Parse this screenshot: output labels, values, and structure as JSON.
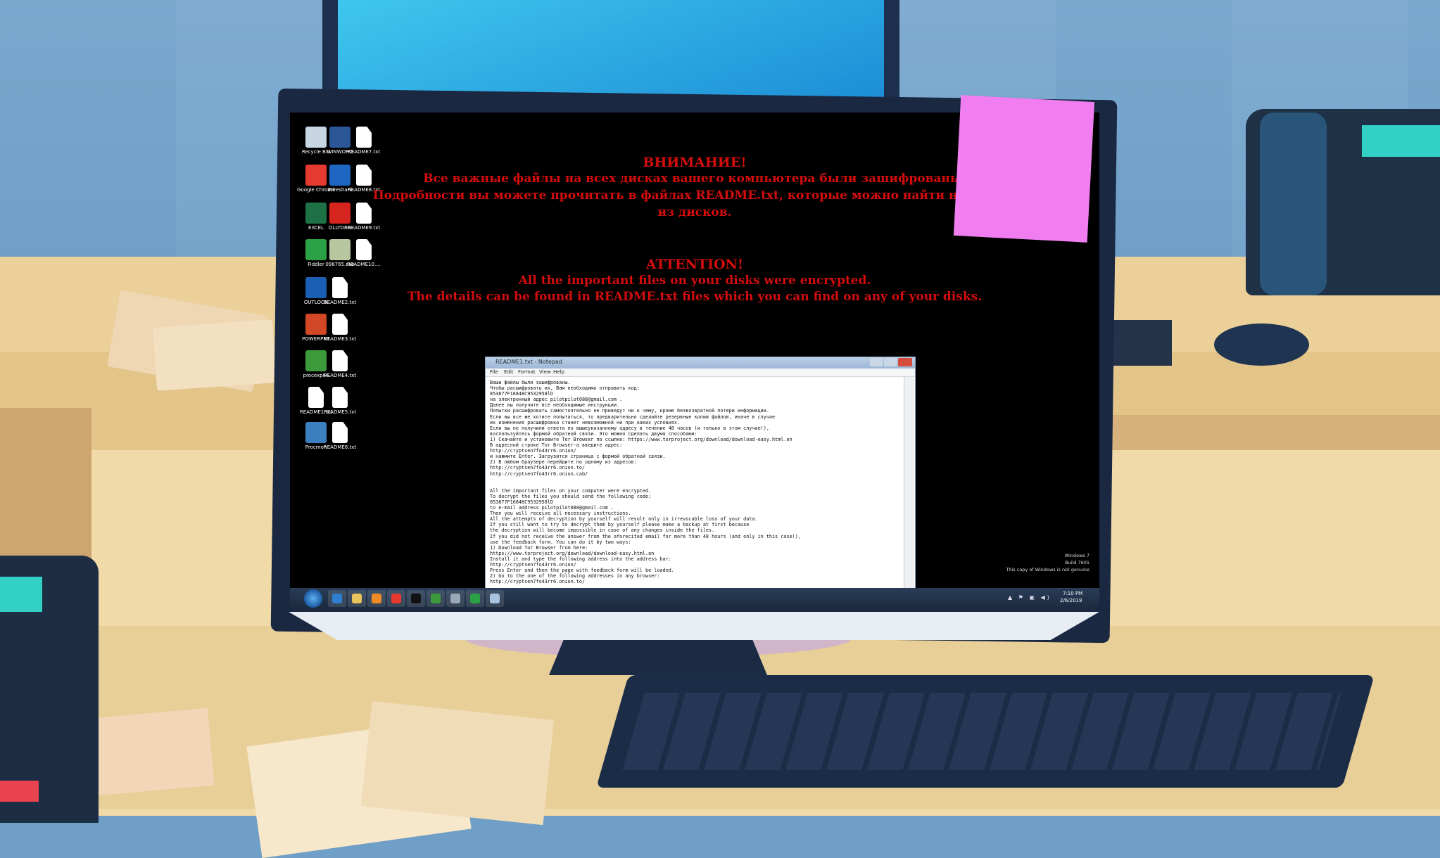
{
  "desktop": {
    "icons": [
      {
        "label": "Recycle Bin",
        "icon": "recycle-bin-icon",
        "color": "#c8d6e4"
      },
      {
        "label": "WINWORD",
        "icon": "word-icon",
        "color": "#2b5797"
      },
      {
        "label": "README7.txt",
        "icon": "text-file-icon",
        "color": "#ffffff"
      },
      {
        "label": "Google Chrome",
        "icon": "chrome-icon",
        "color": "#e6392f"
      },
      {
        "label": "Wireshark",
        "icon": "wireshark-icon",
        "color": "#1f66c2"
      },
      {
        "label": "README8.txt",
        "icon": "text-file-icon",
        "color": "#ffffff"
      },
      {
        "label": "EXCEL",
        "icon": "excel-icon",
        "color": "#1e7145"
      },
      {
        "label": "OLLYDBG",
        "icon": "ollydbg-icon",
        "color": "#d6241f"
      },
      {
        "label": "README9.txt",
        "icon": "text-file-icon",
        "color": "#ffffff"
      },
      {
        "label": "Fiddler",
        "icon": "fiddler-icon",
        "color": "#2aa144"
      },
      {
        "label": "098765.exe",
        "icon": "exe-icon",
        "color": "#b8c7a0"
      },
      {
        "label": "README10....",
        "icon": "text-file-icon",
        "color": "#ffffff"
      },
      {
        "label": "OUTLOOK",
        "icon": "outlook-icon",
        "color": "#1a5fb4"
      },
      {
        "label": "README2.txt",
        "icon": "text-file-icon",
        "color": "#ffffff"
      },
      {
        "label": "POWERPNT",
        "icon": "powerpoint-icon",
        "color": "#d24726"
      },
      {
        "label": "README3.txt",
        "icon": "text-file-icon",
        "color": "#ffffff"
      },
      {
        "label": "procexp64",
        "icon": "procexp-icon",
        "color": "#3c9a3c"
      },
      {
        "label": "README4.txt",
        "icon": "text-file-icon",
        "color": "#ffffff"
      },
      {
        "label": "README1.txt",
        "icon": "text-file-icon",
        "color": "#ffffff"
      },
      {
        "label": "README5.txt",
        "icon": "text-file-icon",
        "color": "#ffffff"
      },
      {
        "label": "Procmon",
        "icon": "procmon-icon",
        "color": "#3c7fc0"
      },
      {
        "label": "README6.txt",
        "icon": "text-file-icon",
        "color": "#ffffff"
      }
    ]
  },
  "ransom_note": {
    "ru_heading": "ВНИМАНИЕ!",
    "ru_line1": "Все важные файлы на всех дисках вашего компьютера были зашифрованы.",
    "ru_line2": "Подробности вы можете прочитать в файлах README.txt, которые можно найти на любом",
    "ru_line3": "из дисков.",
    "en_heading": "ATTENTION!",
    "en_line1": "All the important files on your disks were encrypted.",
    "en_line2": "The details can be found in README.txt files which you can find on any of your disks.",
    "color": "#d40d0d"
  },
  "notepad": {
    "title": "README1.txt - Notepad",
    "menu": [
      "File",
      "Edit",
      "Format",
      "View",
      "Help"
    ],
    "lines": [
      "Ваши файлы были зашифрованы.",
      "Чтобы расшифровать их, Вам необходимо отправить код:",
      "853877F16848C9532958lD",
      "на электронный адрес pilotpilot088@gmail.com .",
      "Далее вы получите все необходимые инструкции.",
      "Попытки расшифровать самостоятельно не приведут ни к чему, кроме безвозвратной потери информации.",
      "Если вы все же хотите попытаться, то предварительно сделайте резервные копии файлов, иначе в случае",
      "их изменения расшифровка станет невозможной ни при каких условиях.",
      "Если вы не получили ответа по вышеуказанному адресу в течение 48 часов (и только в этом случае!),",
      "воспользуйтесь формой обратной связи. Это можно сделать двумя способами:",
      "1) Скачайте и установите Tor Browser по ссылке: https://www.torproject.org/download/download-easy.html.en",
      "В адресной строке Tor Browser-а введите адрес:",
      "http://cryptsen7fo43rr6.onion/",
      "и нажмите Enter. Загрузится страница с формой обратной связи.",
      "2) В любом браузере перейдите по одному из адресов:",
      "http://cryptsen7fo43rr6.onion.to/",
      "http://cryptsen7fo43rr6.onion.cab/",
      "",
      "",
      "All the important files on your computer were encrypted.",
      "To decrypt the files you should send the following code:",
      "853877F16848C9532958lD",
      "to e-mail address pilotpilot088@gmail.com .",
      "Then you will receive all necessary instructions.",
      "All the attempts of decryption by yourself will result only in irrevocable loss of your data.",
      "If you still want to try to decrypt them by yourself please make a backup at first because",
      "the decryption will become impossible in case of any changes inside the files.",
      "If you did not receive the answer from the aforecited email for more than 48 hours (and only in this case!),",
      "use the feedback form. You can do it by two ways:",
      "1) Download Tor Browser from here:",
      "https://www.torproject.org/download/download-easy.html.en",
      "Install it and type the following address into the address bar:",
      "http://cryptsen7fo43rr6.onion/",
      "Press Enter and then the page with feedback form will be loaded.",
      "2) Go to the one of the following addresses in any browser:",
      "http://cryptsen7fo43rr6.onion.to/"
    ]
  },
  "taskbar": {
    "items": [
      {
        "icon": "ie-icon",
        "color": "#2f7fd1"
      },
      {
        "icon": "explorer-icon",
        "color": "#e8c25a"
      },
      {
        "icon": "media-player-icon",
        "color": "#f08a24"
      },
      {
        "icon": "chrome-icon",
        "color": "#e6392f"
      },
      {
        "icon": "cmd-icon",
        "color": "#111111"
      },
      {
        "icon": "procexp-icon",
        "color": "#3c9a3c"
      },
      {
        "icon": "files-icon",
        "color": "#9aa8b8"
      },
      {
        "icon": "fiddler-icon",
        "color": "#2aa144"
      },
      {
        "icon": "notepad-icon",
        "color": "#a9c4e0"
      }
    ],
    "tray_icons": "▲ ⚑ ▣ ◀)",
    "time": "7:10 PM",
    "date": "2/6/2019"
  },
  "watermark": {
    "line1": "Windows 7",
    "line2": "Build 7601",
    "line3": "This copy of Windows is not genuine"
  }
}
